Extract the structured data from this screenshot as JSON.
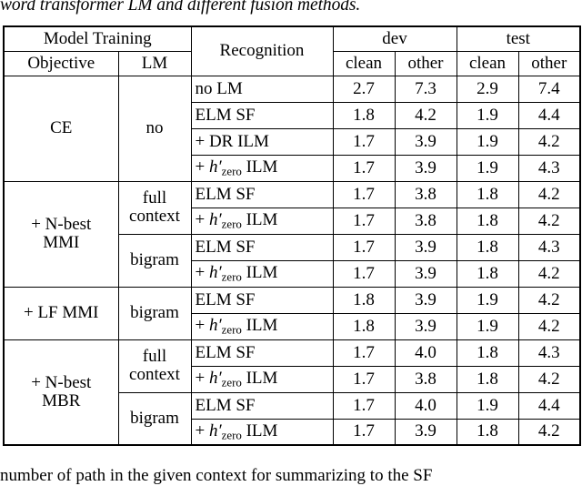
{
  "caption_top": "word transformer LM and different fusion methods.",
  "body_bottom": "number of path in the given context for summarizing to the SF",
  "table": {
    "header": {
      "group_model_training": "Model Training",
      "objective": "Objective",
      "lm": "LM",
      "recognition": "Recognition",
      "dev": "dev",
      "test": "test",
      "dev_clean": "clean",
      "dev_other": "other",
      "test_clean": "clean",
      "test_other": "other"
    },
    "groups": [
      {
        "objective": "CE",
        "lm_blocks": [
          {
            "lm": "no",
            "rows": [
              {
                "recognition": "no LM",
                "math": false,
                "indent": false,
                "dev_clean": "2.7",
                "dev_other": "7.3",
                "test_clean": "2.9",
                "test_other": "7.4"
              },
              {
                "recognition": "ELM SF",
                "math": false,
                "indent": false,
                "dev_clean": "1.8",
                "dev_other": "4.2",
                "test_clean": "1.9",
                "test_other": "4.4"
              },
              {
                "recognition": "+ DR ILM",
                "math": false,
                "indent": true,
                "dev_clean": "1.7",
                "dev_other": "3.9",
                "test_clean": "1.9",
                "test_other": "4.2"
              },
              {
                "recognition": "+ h'zero ILM",
                "math": true,
                "indent": true,
                "dev_clean": "1.7",
                "dev_other": "3.9",
                "test_clean": "1.9",
                "test_other": "4.3"
              }
            ]
          }
        ]
      },
      {
        "objective": "+ N-best MMI",
        "objective_line1": "+ N-best",
        "objective_line2": "MMI",
        "lm_blocks": [
          {
            "lm": "full context",
            "lm_line1": "full",
            "lm_line2": "context",
            "rows": [
              {
                "recognition": "ELM SF",
                "math": false,
                "indent": false,
                "dev_clean": "1.7",
                "dev_other": "3.8",
                "test_clean": "1.8",
                "test_other": "4.2"
              },
              {
                "recognition": "+ h'zero ILM",
                "math": true,
                "indent": true,
                "dev_clean": "1.7",
                "dev_other": "3.8",
                "test_clean": "1.8",
                "test_other": "4.2"
              }
            ]
          },
          {
            "lm": "bigram",
            "rows": [
              {
                "recognition": "ELM SF",
                "math": false,
                "indent": false,
                "dev_clean": "1.7",
                "dev_other": "3.9",
                "test_clean": "1.8",
                "test_other": "4.3"
              },
              {
                "recognition": "+ h'zero ILM",
                "math": true,
                "indent": true,
                "dev_clean": "1.7",
                "dev_other": "3.9",
                "test_clean": "1.8",
                "test_other": "4.2"
              }
            ]
          }
        ]
      },
      {
        "objective": "+ LF MMI",
        "lm_blocks": [
          {
            "lm": "bigram",
            "rows": [
              {
                "recognition": "ELM SF",
                "math": false,
                "indent": false,
                "dev_clean": "1.8",
                "dev_other": "3.9",
                "test_clean": "1.9",
                "test_other": "4.2"
              },
              {
                "recognition": "+ h'zero ILM",
                "math": true,
                "indent": true,
                "dev_clean": "1.8",
                "dev_other": "3.9",
                "test_clean": "1.9",
                "test_other": "4.2"
              }
            ]
          }
        ]
      },
      {
        "objective": "+ N-best MBR",
        "objective_line1": "+ N-best",
        "objective_line2": "MBR",
        "lm_blocks": [
          {
            "lm": "full context",
            "lm_line1": "full",
            "lm_line2": "context",
            "rows": [
              {
                "recognition": "ELM SF",
                "math": false,
                "indent": false,
                "dev_clean": "1.7",
                "dev_other": "4.0",
                "test_clean": "1.8",
                "test_other": "4.3"
              },
              {
                "recognition": "+ h'zero ILM",
                "math": true,
                "indent": true,
                "dev_clean": "1.7",
                "dev_other": "3.8",
                "test_clean": "1.8",
                "test_other": "4.2"
              }
            ]
          },
          {
            "lm": "bigram",
            "rows": [
              {
                "recognition": "ELM SF",
                "math": false,
                "indent": false,
                "dev_clean": "1.7",
                "dev_other": "4.0",
                "test_clean": "1.9",
                "test_other": "4.4"
              },
              {
                "recognition": "+ h'zero ILM",
                "math": true,
                "indent": true,
                "dev_clean": "1.7",
                "dev_other": "3.9",
                "test_clean": "1.8",
                "test_other": "4.2"
              }
            ]
          }
        ]
      }
    ]
  }
}
